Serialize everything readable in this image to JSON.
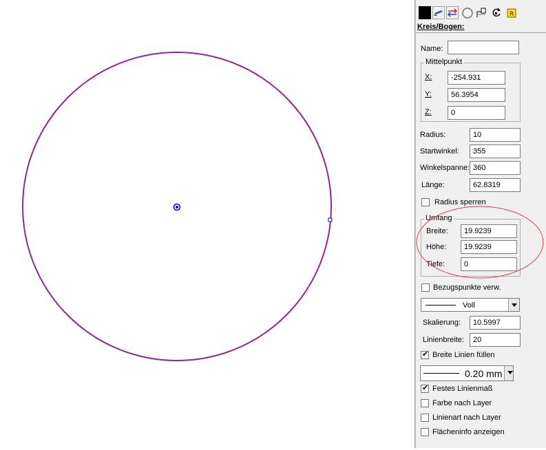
{
  "canvas": {
    "circle_color": "#8b2a8b",
    "center_marker_color": "#0000ff",
    "annotation_color": "#e04040"
  },
  "panel": {
    "title": "Kreis/Bogen:",
    "name": {
      "label": "Name:",
      "value": ""
    },
    "mittelpunkt": {
      "legend": "Mittelpunkt",
      "x": {
        "label": "X:",
        "value": "-254.931"
      },
      "y": {
        "label": "Y:",
        "value": "56.3954"
      },
      "z": {
        "label": "Z:",
        "value": "0"
      }
    },
    "radius": {
      "label": "Radius:",
      "value": "10"
    },
    "startwinkel": {
      "label": "Startwinkel:",
      "value": "355"
    },
    "winkelspanne": {
      "label": "Winkelspanne:",
      "value": "360"
    },
    "laenge": {
      "label": "Länge:",
      "value": "62.8319"
    },
    "radius_sperren": {
      "label": "Radius sperren",
      "checked": false
    },
    "umfang": {
      "legend": "Umfang",
      "breite": {
        "label": "Breite:",
        "value": "19.9239"
      },
      "hoehe": {
        "label": "Höhe:",
        "value": "19.9239"
      },
      "tiefe": {
        "label": "Tiefe:",
        "value": "0"
      }
    },
    "bezugspunkte": {
      "label": "Bezugspunkte verw.",
      "checked": false
    },
    "linestyle": {
      "value": "Voll"
    },
    "skalierung": {
      "label": "Skalierung:",
      "value": "10.5997"
    },
    "linienbreite": {
      "label": "Linienbreite:",
      "value": "20"
    },
    "breite_linien": {
      "label": "Breite Linien füllen",
      "checked": true
    },
    "linewidth": {
      "value": "0.20 mm"
    },
    "festes": {
      "label": "Festes Linienmaß",
      "checked": true
    },
    "farbe": {
      "label": "Farbe nach Layer",
      "checked": false
    },
    "linienart": {
      "label": "Linienart nach Layer",
      "checked": false
    },
    "flaeche": {
      "label": "Flächeninfo anzeigen",
      "checked": false
    },
    "check_mark": "✔",
    "toolbar": [
      "color-swatch",
      "pen-icon",
      "arrows-icon",
      "circle-icon",
      "measure-icon",
      "rotate-icon",
      "layer-icon"
    ]
  }
}
